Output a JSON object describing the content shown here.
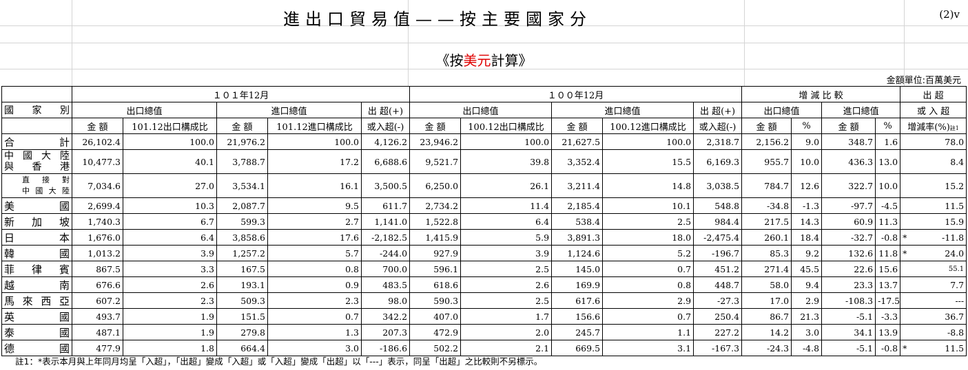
{
  "title": "進出口貿易值——按主要國家分",
  "page_code": "(2)v",
  "subtitle": {
    "left": "《按",
    "red": "美元",
    "right": "計算》"
  },
  "unit": "金額單位:百萬美元",
  "header": {
    "country": "國 家 別",
    "year_cur": "１０１年12月",
    "year_prev": "１００年12月",
    "compare": "增 減 比 較",
    "net_top": "出 超",
    "net_bottom": "或 入 超",
    "export_total": "出口總值",
    "import_total": "進口總值",
    "balance_top": "出 超(+)",
    "balance_bottom": "或入超(-)",
    "amount": "金 額",
    "pct": "%",
    "cur_export_share": "101.12出口構成比",
    "cur_import_share": "101.12進口構成比",
    "prev_export_share": "100.12出口構成比",
    "prev_import_share": "100.12進口構成比",
    "rate": "增減率(%)",
    "rate_note": "註1"
  },
  "rows": [
    {
      "name": "合 計",
      "c": [
        "26,102.4",
        "100.0",
        "21,976.2",
        "100.0",
        "4,126.2",
        "23,946.2",
        "100.0",
        "21,627.5",
        "100.0",
        "2,318.7",
        "2,156.2",
        "9.0",
        "348.7",
        "1.6"
      ],
      "star": "",
      "rate": "78.0"
    },
    {
      "name": "中國大陸",
      "name2": "與 香 港",
      "c": [
        "10,477.3",
        "40.1",
        "3,788.7",
        "17.2",
        "6,688.6",
        "9,521.7",
        "39.8",
        "3,352.4",
        "15.5",
        "6,169.3",
        "955.7",
        "10.0",
        "436.3",
        "13.0"
      ],
      "star": "",
      "rate": "8.4"
    },
    {
      "name": "直接對",
      "name2": "中國大陸",
      "c": [
        "7,034.6",
        "27.0",
        "3,534.1",
        "16.1",
        "3,500.5",
        "6,250.0",
        "26.1",
        "3,211.4",
        "14.8",
        "3,038.5",
        "784.7",
        "12.6",
        "322.7",
        "10.0"
      ],
      "star": "",
      "rate": "15.2"
    },
    {
      "name": "美 國",
      "c": [
        "2,699.4",
        "10.3",
        "2,087.7",
        "9.5",
        "611.7",
        "2,734.2",
        "11.4",
        "2,185.4",
        "10.1",
        "548.8",
        "-34.8",
        "-1.3",
        "-97.7",
        "-4.5"
      ],
      "star": "",
      "rate": "11.5"
    },
    {
      "name": "新 加 坡",
      "c": [
        "1,740.3",
        "6.7",
        "599.3",
        "2.7",
        "1,141.0",
        "1,522.8",
        "6.4",
        "538.4",
        "2.5",
        "984.4",
        "217.5",
        "14.3",
        "60.9",
        "11.3"
      ],
      "star": "",
      "rate": "15.9"
    },
    {
      "name": "日 本",
      "c": [
        "1,676.0",
        "6.4",
        "3,858.6",
        "17.6",
        "-2,182.5",
        "1,415.9",
        "5.9",
        "3,891.3",
        "18.0",
        "-2,475.4",
        "260.1",
        "18.4",
        "-32.7",
        "-0.8"
      ],
      "star": "*",
      "rate": "-11.8"
    },
    {
      "name": "韓 國",
      "c": [
        "1,013.2",
        "3.9",
        "1,257.2",
        "5.7",
        "-244.0",
        "927.9",
        "3.9",
        "1,124.6",
        "5.2",
        "-196.7",
        "85.3",
        "9.2",
        "132.6",
        "11.8"
      ],
      "star": "*",
      "rate": "24.0"
    },
    {
      "name": "菲 律 賓",
      "c": [
        "867.5",
        "3.3",
        "167.5",
        "0.8",
        "700.0",
        "596.1",
        "2.5",
        "145.0",
        "0.7",
        "451.2",
        "271.4",
        "45.5",
        "22.6",
        "15.6"
      ],
      "star": "",
      "rate": "55.1"
    },
    {
      "name": "越 南",
      "c": [
        "676.6",
        "2.6",
        "193.1",
        "0.9",
        "483.5",
        "618.6",
        "2.6",
        "169.9",
        "0.8",
        "448.7",
        "58.0",
        "9.4",
        "23.3",
        "13.7"
      ],
      "star": "",
      "rate": "7.7"
    },
    {
      "name": "馬來西亞",
      "c": [
        "607.2",
        "2.3",
        "509.3",
        "2.3",
        "98.0",
        "590.3",
        "2.5",
        "617.6",
        "2.9",
        "-27.3",
        "17.0",
        "2.9",
        "-108.3",
        "-17.5"
      ],
      "star": "",
      "rate": "---"
    },
    {
      "name": "英 國",
      "c": [
        "493.7",
        "1.9",
        "151.5",
        "0.7",
        "342.2",
        "407.0",
        "1.7",
        "156.6",
        "0.7",
        "250.4",
        "86.7",
        "21.3",
        "-5.1",
        "-3.3"
      ],
      "star": "",
      "rate": "36.7"
    },
    {
      "name": "泰 國",
      "c": [
        "487.1",
        "1.9",
        "279.8",
        "1.3",
        "207.3",
        "472.9",
        "2.0",
        "245.7",
        "1.1",
        "227.2",
        "14.2",
        "3.0",
        "34.1",
        "13.9"
      ],
      "star": "",
      "rate": "-8.8"
    },
    {
      "name": "德 國",
      "c": [
        "477.9",
        "1.8",
        "664.4",
        "3.0",
        "-186.6",
        "502.2",
        "2.1",
        "669.5",
        "3.1",
        "-167.3",
        "-24.3",
        "-4.8",
        "-5.1",
        "-0.8"
      ],
      "star": "*",
      "rate": "11.5"
    }
  ],
  "note": "註1：*表示本月與上年同月均呈「入超」，「出超」變成「入超」或「入超」變成「出超」以「---」表示，同呈「出超」之比較則不另標示。"
}
